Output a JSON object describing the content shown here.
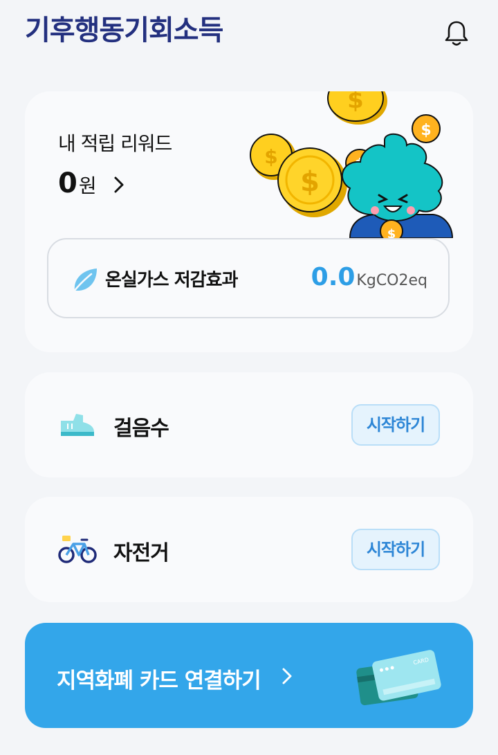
{
  "header": {
    "logo_text": "기후행동기회소득",
    "notification_icon": "bell-icon"
  },
  "reward": {
    "label": "내 적립 리워드",
    "amount": "0",
    "unit": "원",
    "ghg": {
      "label": "온실가스 저감효과",
      "value": "0.0",
      "unit": "KgCO2eq"
    }
  },
  "activities": [
    {
      "icon": "shoe-icon",
      "label": "걸음수",
      "button": "시작하기"
    },
    {
      "icon": "bicycle-icon",
      "label": "자전거",
      "button": "시작하기"
    }
  ],
  "card_link": {
    "label": "지역화폐 카드 연결하기",
    "card_text": "CARD"
  },
  "colors": {
    "accent_blue": "#33a6ea",
    "value_blue": "#2d9ee6",
    "logo_navy": "#23307f",
    "background": "#f3f5f8"
  }
}
